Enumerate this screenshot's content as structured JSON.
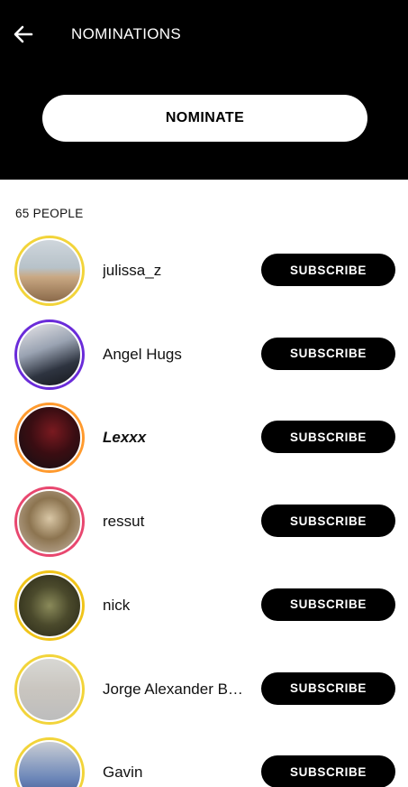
{
  "header": {
    "title": "NOMINATIONS",
    "back_icon": "arrow-left-icon",
    "nominate_label": "NOMINATE"
  },
  "list": {
    "count_label": "65 PEOPLE",
    "subscribe_label": "SUBSCRIBE",
    "people": [
      {
        "name": "julissa_z",
        "ring": "#f2d43a",
        "bg": "linear-gradient(180deg,#cfd6dc 0%,#b7c2c9 45%,#c9a883 60%,#8b6a4a 100%)"
      },
      {
        "name": "Angel Hugs",
        "ring": "#6a2bd9",
        "bg": "linear-gradient(160deg,#e9e7ea 0%,#9aa3b2 40%,#2e3440 70%,#15171c 100%)"
      },
      {
        "name": "Lexxx",
        "ring": "#ff9a2e",
        "bg": "radial-gradient(circle at 55% 40%,#7a1a20 0%,#3a0d12 45%,#101014 100%)"
      },
      {
        "name": "ressut",
        "ring": "#e8476f",
        "bg": "radial-gradient(circle at 50% 45%,#d9c7a6 0%,#8c7450 45%,#c8b8a8 100%)"
      },
      {
        "name": "nick",
        "ring": "#f0c419",
        "bg": "radial-gradient(circle at 50% 50%,#8a8a5a 0%,#4b4a2c 45%,#262515 100%)"
      },
      {
        "name": "Jorge Alexander Brito Herrera",
        "ring": "#f2d43a",
        "bg": "linear-gradient(180deg,#d8d8d4 0%,#c9c5bf 50%,#bdbdbd 100%)"
      },
      {
        "name": "Gavin",
        "ring": "#f2d43a",
        "bg": "linear-gradient(180deg,#c9cdd4 0%,#6b86b8 60%,#3a4f8a 100%)"
      }
    ]
  }
}
